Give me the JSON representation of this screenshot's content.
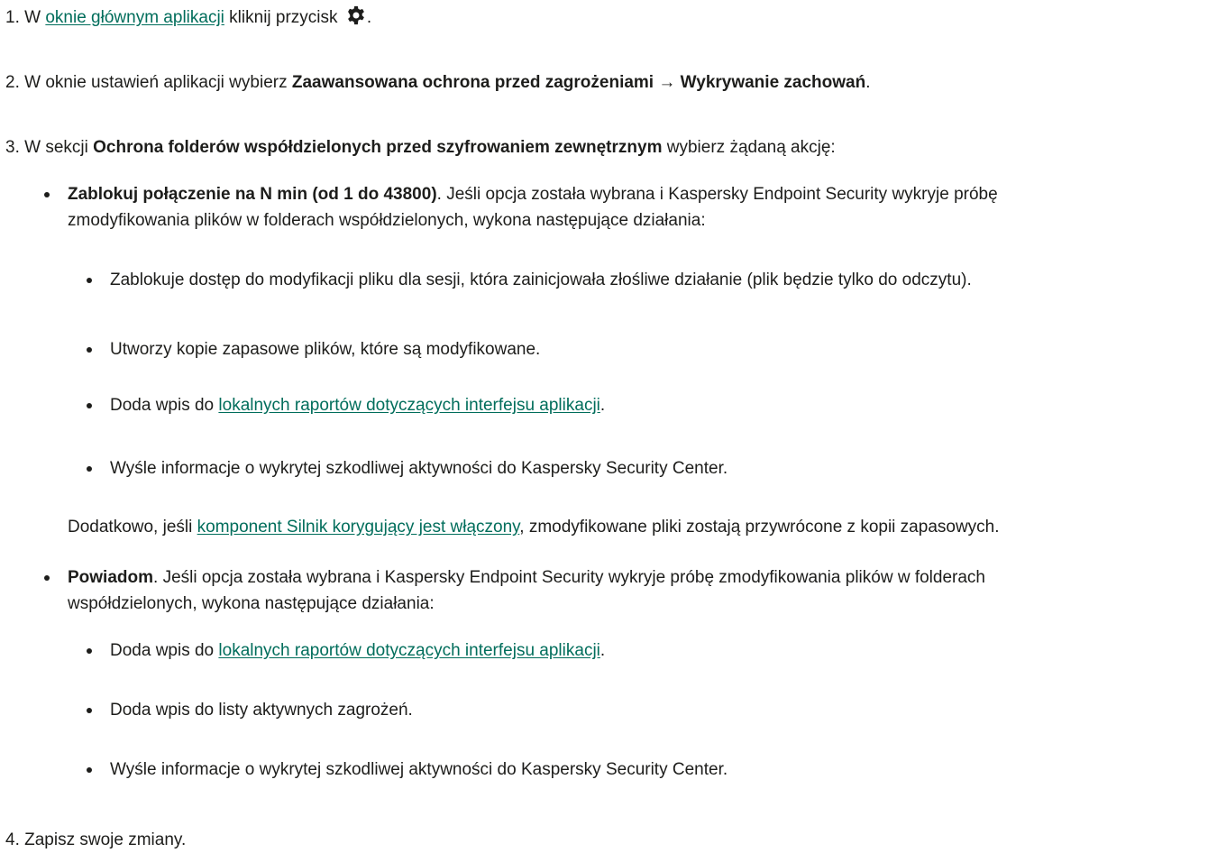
{
  "steps": {
    "s1": {
      "num": "1.",
      "pre": " W ",
      "link": "oknie głównym aplikacji",
      "post": " kliknij przycisk ",
      "end": "."
    },
    "s2": {
      "num": "2.",
      "pre": " W oknie ustawień aplikacji wybierz ",
      "bold1": "Zaawansowana ochrona przed zagrożeniami",
      "arrow": " → ",
      "bold2": "Wykrywanie zachowań",
      "end": "."
    },
    "s3": {
      "num": "3.",
      "pre": " W sekcji ",
      "bold": "Ochrona folderów współdzielonych przed szyfrowaniem zewnętrznym",
      "post": " wybierz żądaną akcję:"
    },
    "s4": {
      "num": "4.",
      "text": " Zapisz swoje zmiany."
    }
  },
  "block_option": {
    "bold": "Zablokuj połączenie na N min (od 1 do 43800)",
    "line1_rest": ". Jeśli opcja została wybrana i Kaspersky Endpoint Security wykryje próbę",
    "line2": "zmodyfikowania plików w folderach współdzielonych, wykona następujące działania:",
    "items": {
      "i1": "Zablokuje dostęp do modyfikacji pliku dla sesji, która zainicjowała złośliwe działanie (plik będzie tylko do odczytu).",
      "i2": "Utworzy kopie zapasowe plików, które są modyfikowane.",
      "i3_pre": "Doda wpis do ",
      "i3_link": "lokalnych raportów dotyczących interfejsu aplikacji",
      "i3_end": ".",
      "i4": "Wyśle informacje o wykrytej szkodliwej aktywności do Kaspersky Security Center."
    },
    "note_pre": "Dodatkowo, jeśli ",
    "note_link": "komponent Silnik korygujący jest włączony",
    "note_post": ", zmodyfikowane pliki zostają przywrócone z kopii zapasowych."
  },
  "notify_option": {
    "bold": "Powiadom",
    "line1_rest": ". Jeśli opcja została wybrana i Kaspersky Endpoint Security wykryje próbę zmodyfikowania plików w folderach",
    "line2": "współdzielonych, wykona następujące działania:",
    "items": {
      "i1_pre": "Doda wpis do ",
      "i1_link": "lokalnych raportów dotyczących interfejsu aplikacji",
      "i1_end": ".",
      "i2": "Doda wpis do listy aktywnych zagrożeń.",
      "i3": "Wyśle informacje o wykrytej szkodliwej aktywności do Kaspersky Security Center."
    }
  },
  "icons": {
    "settings": "gear-icon"
  },
  "colors": {
    "text": "#1d1d1b",
    "link": "#006d5b"
  }
}
